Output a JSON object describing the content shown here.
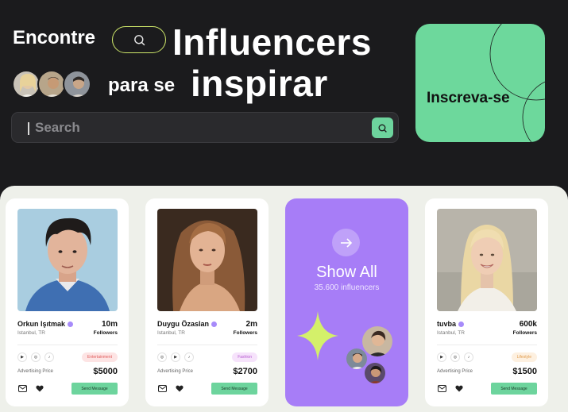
{
  "hero": {
    "word_find": "Encontre",
    "word_influencers": "Influencers",
    "word_for": "para se",
    "word_inspire": "inspirar",
    "search_icon": "search-icon"
  },
  "search": {
    "placeholder": "Search",
    "button_icon": "search-icon"
  },
  "subscribe": {
    "label": "Inscreva-se"
  },
  "cards": [
    {
      "name": "Orkun Işıtmak",
      "location": "Istanbul, TR",
      "followers": "10m",
      "followers_label": "Followers",
      "category": "Entertainment",
      "price_label": "Advertising Price",
      "price": "$5000",
      "cta": "Send Message",
      "tag_bg": "#fde4e4",
      "tag_fg": "#e05a5a"
    },
    {
      "name": "Duygu Özaslan",
      "location": "Istanbul, TR",
      "followers": "2m",
      "followers_label": "Followers",
      "category": "Fashion",
      "price_label": "Advertising Price",
      "price": "$2700",
      "cta": "Send Message",
      "tag_bg": "#f6e3fb",
      "tag_fg": "#b65ad0"
    },
    {
      "name": "tuvba",
      "location": "Istanbul, TR",
      "followers": "600k",
      "followers_label": "Followers",
      "category": "Lifestyle",
      "price_label": "Advertising Price",
      "price": "$1500",
      "cta": "Send Message",
      "tag_bg": "#fdf0e0",
      "tag_fg": "#e09a4a"
    }
  ],
  "show_all": {
    "title": "Show All",
    "count": "35.600 influencers",
    "icon": "arrow-right-icon"
  },
  "colors": {
    "accent_green": "#6dd49d",
    "accent_purple": "#a77df7",
    "lime": "#cfe86a",
    "background": "#1b1b1d"
  }
}
